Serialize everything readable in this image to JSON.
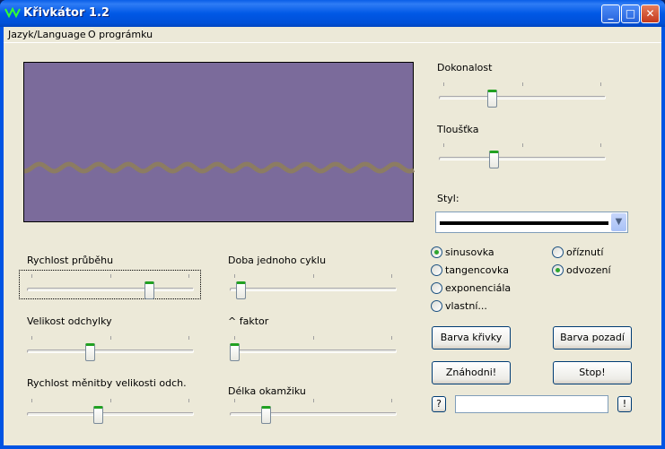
{
  "window": {
    "title": "Křivkátor 1.2",
    "minimize": "_",
    "maximize": "□",
    "close": "✕"
  },
  "menu": [
    "Jazyk/Language",
    "O programku"
  ],
  "canvas": {
    "background": "#7b6b9b",
    "curve_color": "#8c7c62"
  },
  "sliders": {
    "rychlost_prubehu": {
      "label": "Rychlost průběhu",
      "value": 0.75
    },
    "velikost_odchylky": {
      "label": "Velikost odchylky",
      "value": 0.37
    },
    "rychlost_menitby": {
      "label": "Rychlost měnitby velikosti odch.",
      "value": 0.42
    },
    "doba_cyklu": {
      "label": "Doba jednoho cyklu",
      "value": 0.04
    },
    "faktor": {
      "label": "^ faktor",
      "value": 0.0
    },
    "delka_okamziku": {
      "label": "Délka okamžiku",
      "value": 0.2
    },
    "dokonalost": {
      "label": "Dokonalost",
      "value": 0.31
    },
    "tloustka": {
      "label": "Tloušťka",
      "value": 0.32
    }
  },
  "styl": {
    "label": "Styl:",
    "arrow": "▼"
  },
  "radios_left": [
    {
      "label": "sinusovka",
      "checked": true
    },
    {
      "label": "tangencovka",
      "checked": false
    },
    {
      "label": "exponenciála",
      "checked": false
    },
    {
      "label": "vlastní...",
      "checked": false
    }
  ],
  "radios_right": [
    {
      "label": "oříznutí",
      "checked": false
    },
    {
      "label": "odvození",
      "checked": true
    }
  ],
  "buttons": {
    "barva_krivky": "Barva křivky",
    "barva_pozadi": "Barva pozadí",
    "znahodni": "Znáhodni!",
    "stop": "Stop!",
    "help": "?",
    "exclaim": "!"
  },
  "input": {
    "value": ""
  }
}
